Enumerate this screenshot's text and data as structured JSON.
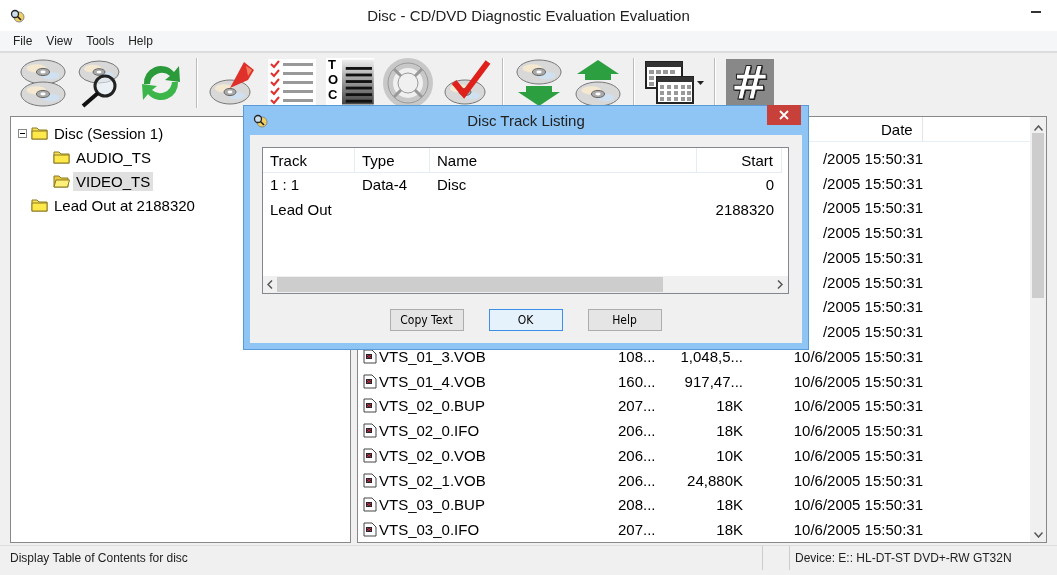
{
  "window": {
    "title": "Disc - CD/DVD Diagnostic Evaluation Evaluation"
  },
  "menu": [
    "File",
    "View",
    "Tools",
    "Help"
  ],
  "toolbar": [
    [
      {
        "kind": "stacked-discs"
      },
      {
        "kind": "disc-magnifier"
      },
      {
        "kind": "refresh"
      }
    ],
    [
      {
        "kind": "disc-flame"
      },
      {
        "kind": "checklist"
      },
      {
        "kind": "toc",
        "text": "TOC"
      },
      {
        "kind": "lifebuoy"
      },
      {
        "kind": "disc-check"
      }
    ],
    [
      {
        "kind": "disc-down"
      },
      {
        "kind": "disc-up"
      }
    ],
    [
      {
        "kind": "grid-window"
      }
    ],
    [
      {
        "kind": "hash",
        "text": "#"
      }
    ]
  ],
  "tree": [
    {
      "label": "Disc (Session 1)",
      "expanded": true,
      "selected": false,
      "children": [
        {
          "label": "AUDIO_TS",
          "selected": false
        },
        {
          "label": "VIDEO_TS",
          "selected": true
        }
      ]
    },
    {
      "label": "Lead Out at 2188320",
      "selected": false
    }
  ],
  "file_list": {
    "date_header": "Date",
    "rows": [
      {
        "date": "/2005 15:50:31"
      },
      {
        "date": "/2005 15:50:31"
      },
      {
        "date": "/2005 15:50:31"
      },
      {
        "date": "/2005 15:50:31"
      },
      {
        "date": "/2005 15:50:31"
      },
      {
        "date": "/2005 15:50:31"
      },
      {
        "date": "/2005 15:50:31"
      },
      {
        "date": "/2005 15:50:31"
      },
      {
        "name": "VTS_01_3.VOB",
        "column_2": "108...",
        "column_3": "1,048,5...",
        "date": "10/6/2005 15:50:31"
      },
      {
        "name": "VTS_01_4.VOB",
        "column_2": "160...",
        "column_3": "917,47...",
        "date": "10/6/2005 15:50:31"
      },
      {
        "name": "VTS_02_0.BUP",
        "column_2": "207...",
        "column_3": "18K",
        "date": "10/6/2005 15:50:31"
      },
      {
        "name": "VTS_02_0.IFO",
        "column_2": "206...",
        "column_3": "18K",
        "date": "10/6/2005 15:50:31"
      },
      {
        "name": "VTS_02_0.VOB",
        "column_2": "206...",
        "column_3": "10K",
        "date": "10/6/2005 15:50:31"
      },
      {
        "name": "VTS_02_1.VOB",
        "column_2": "206...",
        "column_3": "24,880K",
        "date": "10/6/2005 15:50:31"
      },
      {
        "name": "VTS_03_0.BUP",
        "column_2": "208...",
        "column_3": "18K",
        "date": "10/6/2005 15:50:31"
      },
      {
        "name": "VTS_03_0.IFO",
        "column_2": "207...",
        "column_3": "18K",
        "date": "10/6/2005 15:50:31"
      }
    ]
  },
  "dialog": {
    "title": "Disc Track Listing",
    "columns": [
      "Track",
      "Type",
      "Name",
      "Start"
    ],
    "rows": [
      {
        "track": "1 : 1",
        "type": "Data-4",
        "name": "Disc",
        "start": "0"
      },
      {
        "track": "Lead Out",
        "start": "2188320"
      }
    ],
    "buttons": [
      {
        "label": "Copy Text",
        "default": false
      },
      {
        "label": "OK",
        "default": true
      },
      {
        "label": "Help",
        "default": false
      }
    ]
  },
  "status_bar": {
    "message": "Display Table of Contents for disc",
    "device": "Device: E:: HL-DT-ST DVD+-RW GT32N"
  }
}
